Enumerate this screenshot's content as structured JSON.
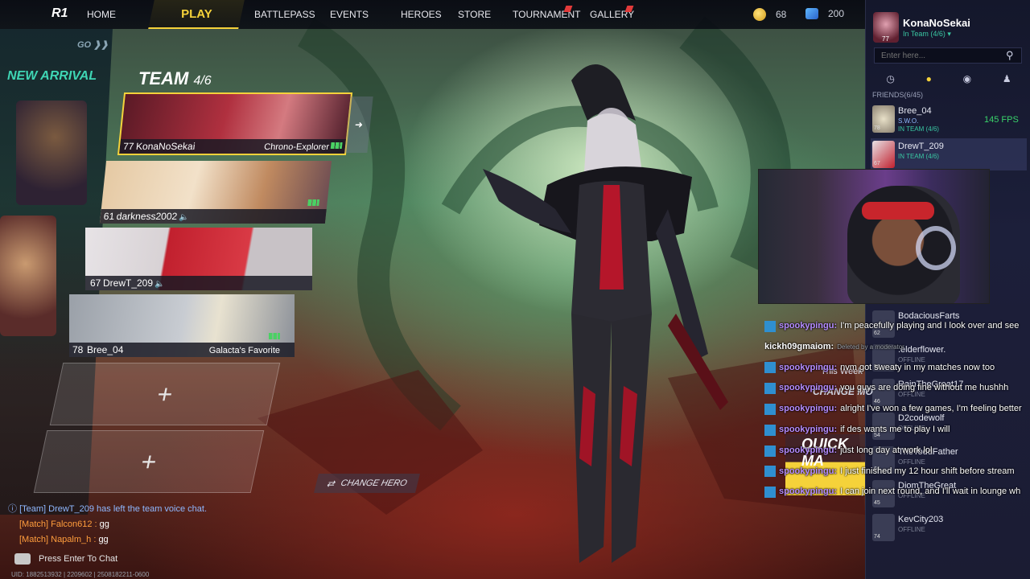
{
  "nav": {
    "logo": "R1",
    "home": "HOME",
    "play": "PLAY",
    "items": [
      "BATTLEPASS",
      "EVENTS",
      "HEROES",
      "STORE",
      "TOURNAMENT",
      "GALLERY"
    ],
    "coins": "68",
    "gems": "200"
  },
  "arrival": {
    "go": "GO",
    "title": "NEW ARRIVAL"
  },
  "team": {
    "title": "TEAM",
    "count": "4/6",
    "slots": [
      {
        "level": "77",
        "name": "KonaNoSekai",
        "hero": "Chrono-Explorer"
      },
      {
        "level": "61",
        "name": "darkness2002",
        "hero": ""
      },
      {
        "level": "67",
        "name": "DrewT_209",
        "hero": ""
      },
      {
        "level": "78",
        "name": "Bree_04",
        "hero": "Galacta's Favorite"
      }
    ],
    "empty": "+"
  },
  "change_hero": "CHANGE HERO",
  "game_chat": {
    "team_line": "[Team] DrewT_209 has left the team voice chat.",
    "match": [
      {
        "tag": "[Match] Falcon612 :",
        "msg": "gg"
      },
      {
        "tag": "[Match] Napalm_h :",
        "msg": "gg"
      }
    ],
    "enter": "Press Enter To Chat",
    "uid": "UID: 1882513932 | 2209602 | 2508182211-0600"
  },
  "panel": {
    "me_level": "77",
    "me_name": "KonaNoSekai",
    "me_status": "In Team (4/6)",
    "search_placeholder": "Enter here...",
    "friends_header": "FRIENDS(6/45)",
    "friends": [
      {
        "name": "Bree_04",
        "status": "S.W.O.",
        "status2": "IN TEAM (4/6)",
        "level": "78",
        "fps": "145 FPS"
      },
      {
        "name": "DrewT_209",
        "status": "IN TEAM (4/6)",
        "level": "67"
      },
      {
        "name": "BodaciousFarts",
        "status": "",
        "level": "62"
      },
      {
        "name": ".elderflower.",
        "status": "OFFLINE",
        "level": "52"
      },
      {
        "name": "RainTheGreat17",
        "status": "OFFLINE",
        "level": "46"
      },
      {
        "name": "D2codewolf",
        "status": "OFFLINE",
        "level": "54"
      },
      {
        "name": "TheToddFather",
        "status": "OFFLINE",
        "level": "61"
      },
      {
        "name": "DiomTheGreat",
        "status": "OFFLINE",
        "level": "45"
      },
      {
        "name": "KevCity203",
        "status": "OFFLINE",
        "level": "74"
      }
    ]
  },
  "stream_chat": [
    {
      "user": "spookypingu:",
      "msg": "I'm peacefully playing and I look over and see"
    },
    {
      "user": "kickh09gmaiom:",
      "msg": "Deleted by a moderator",
      "deleted": true
    },
    {
      "user": "spookypingu:",
      "msg": "nvm got sweaty in my matches now too"
    },
    {
      "user": "spookypingu:",
      "msg": "you guys are doing fine without me hushhh"
    },
    {
      "user": "spookypingu:",
      "msg": "alright I've won a few games, I'm feeling better"
    },
    {
      "user": "spookypingu:",
      "msg": "if des wants me to play I will"
    },
    {
      "user": "spookypingu:",
      "msg": "just long day at work lol"
    },
    {
      "user": "spookypingu:",
      "msg": "I just finished my 12 hour shift before stream"
    },
    {
      "user": "spookypingu:",
      "msg": "I can join next round, and I'll wait in lounge wh"
    }
  ],
  "overlay_bits": {
    "this_week": "This Week",
    "change_mode": "CHANGE MO",
    "quick_match": "QUICK MA"
  },
  "colors": {
    "accent": "#f5d23a",
    "teal": "#3fd6b4",
    "panel": "#1a1d35",
    "online": "#39c7a3",
    "match": "#ff9d3d"
  }
}
